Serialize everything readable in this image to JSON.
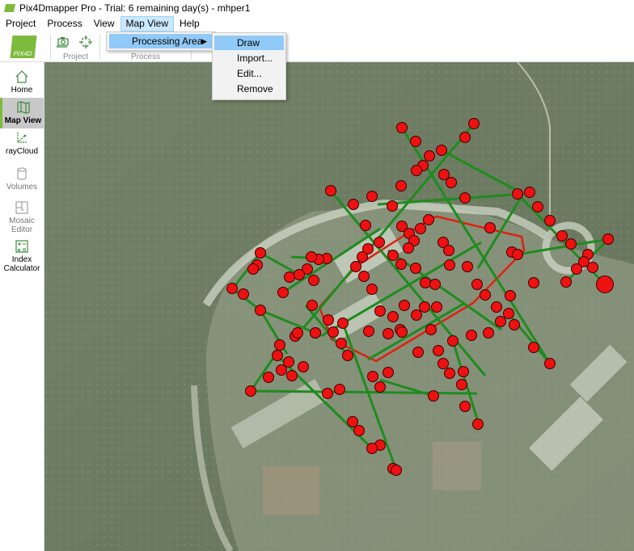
{
  "window": {
    "title": "Pix4Dmapper Pro - Trial: 6 remaining day(s) - mhper1"
  },
  "menubar": {
    "items": [
      "Project",
      "Process",
      "View",
      "Map View",
      "Help"
    ],
    "active": "Map View"
  },
  "ribbon": {
    "logo_text": "PIX4D",
    "groups": [
      {
        "label": "Project"
      },
      {
        "label": "Process"
      }
    ],
    "buttons": [
      {
        "icon": "camera-stack-icon"
      },
      {
        "icon": "crosshair-target-icon"
      }
    ]
  },
  "sidebar": {
    "items": [
      {
        "label": "Home",
        "icon": "home-icon",
        "state": "normal"
      },
      {
        "label": "Map View",
        "icon": "map-icon",
        "state": "active"
      },
      {
        "label": "rayCloud",
        "icon": "raycloud-axes-icon",
        "state": "normal"
      },
      {
        "label": "Volumes",
        "icon": "cylinder-icon",
        "state": "disabled"
      },
      {
        "label": "Mosaic Editor",
        "icon": "mosaic-editor-icon",
        "state": "disabled"
      },
      {
        "label": "Index Calculator",
        "icon": "calculator-icon",
        "state": "normal"
      }
    ]
  },
  "menus": {
    "map_view": {
      "items": [
        {
          "label": "Processing Area",
          "submenu": true,
          "highlighted": true
        }
      ]
    },
    "processing_area": {
      "items": [
        {
          "label": "Draw",
          "highlighted": true
        },
        {
          "label": "Import..."
        },
        {
          "label": "Edit..."
        },
        {
          "label": "Remove"
        }
      ]
    }
  },
  "map": {
    "colors": {
      "node": "#ee1111",
      "flight_line": "#1e8c1e",
      "processing_area": "#dd2211"
    }
  }
}
